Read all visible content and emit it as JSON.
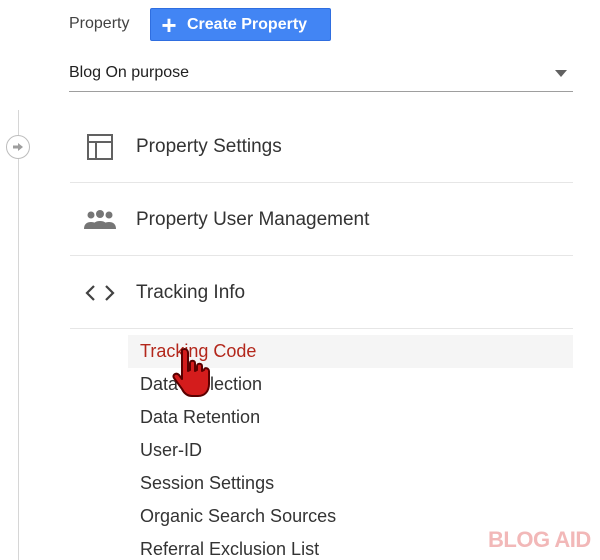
{
  "header": {
    "property_label": "Property",
    "create_button_label": "Create Property",
    "selected_property": "Blog On purpose"
  },
  "menu": {
    "items": [
      {
        "label": "Property Settings",
        "icon": "layout-icon"
      },
      {
        "label": "Property User Management",
        "icon": "people-icon"
      },
      {
        "label": "Tracking Info",
        "icon": "code-icon"
      }
    ],
    "submenu": [
      {
        "label": "Tracking Code",
        "active": true
      },
      {
        "label": "Data Collection"
      },
      {
        "label": "Data Retention"
      },
      {
        "label": "User-ID"
      },
      {
        "label": "Session Settings"
      },
      {
        "label": "Organic Search Sources"
      },
      {
        "label": "Referral Exclusion List"
      }
    ]
  },
  "watermark": "BLOG AID",
  "colors": {
    "accent": "#4285f4",
    "active_text": "#b3271b"
  }
}
